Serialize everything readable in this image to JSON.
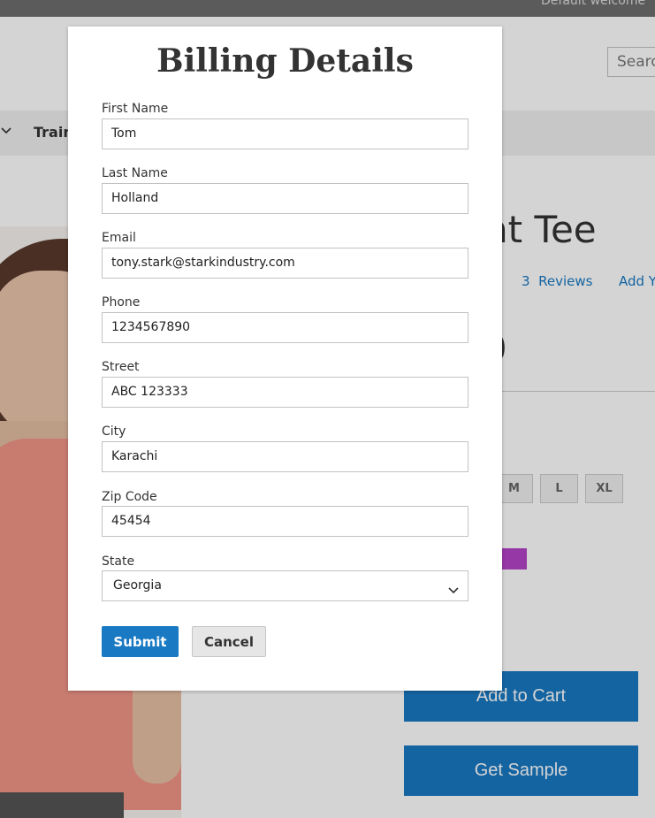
{
  "store": {
    "welcome_text": "Default welcome",
    "search_placeholder": "Searc",
    "nav_item": "Train",
    "product_title": "nt Tee",
    "reviews_count": "3",
    "reviews_label": "Reviews",
    "add_review": "Add Y",
    "price_partial": "0",
    "sizes": [
      "M",
      "L",
      "XL"
    ],
    "swatch_color": "#b545c8",
    "add_to_cart": "Add to Cart",
    "get_sample": "Get Sample",
    "primary_color": "#1979c3"
  },
  "modal": {
    "title": "Billing Details",
    "fields": {
      "first_name": {
        "label": "First Name",
        "value": "Tom"
      },
      "last_name": {
        "label": "Last Name",
        "value": "Holland"
      },
      "email": {
        "label": "Email",
        "value": "tony.stark@starkindustry.com"
      },
      "phone": {
        "label": "Phone",
        "value": "1234567890"
      },
      "street": {
        "label": "Street",
        "value": "ABC 123333"
      },
      "city": {
        "label": "City",
        "value": "Karachi"
      },
      "zip": {
        "label": "Zip Code",
        "value": "45454"
      },
      "state": {
        "label": "State",
        "value": "Georgia"
      }
    },
    "submit_label": "Submit",
    "cancel_label": "Cancel"
  }
}
